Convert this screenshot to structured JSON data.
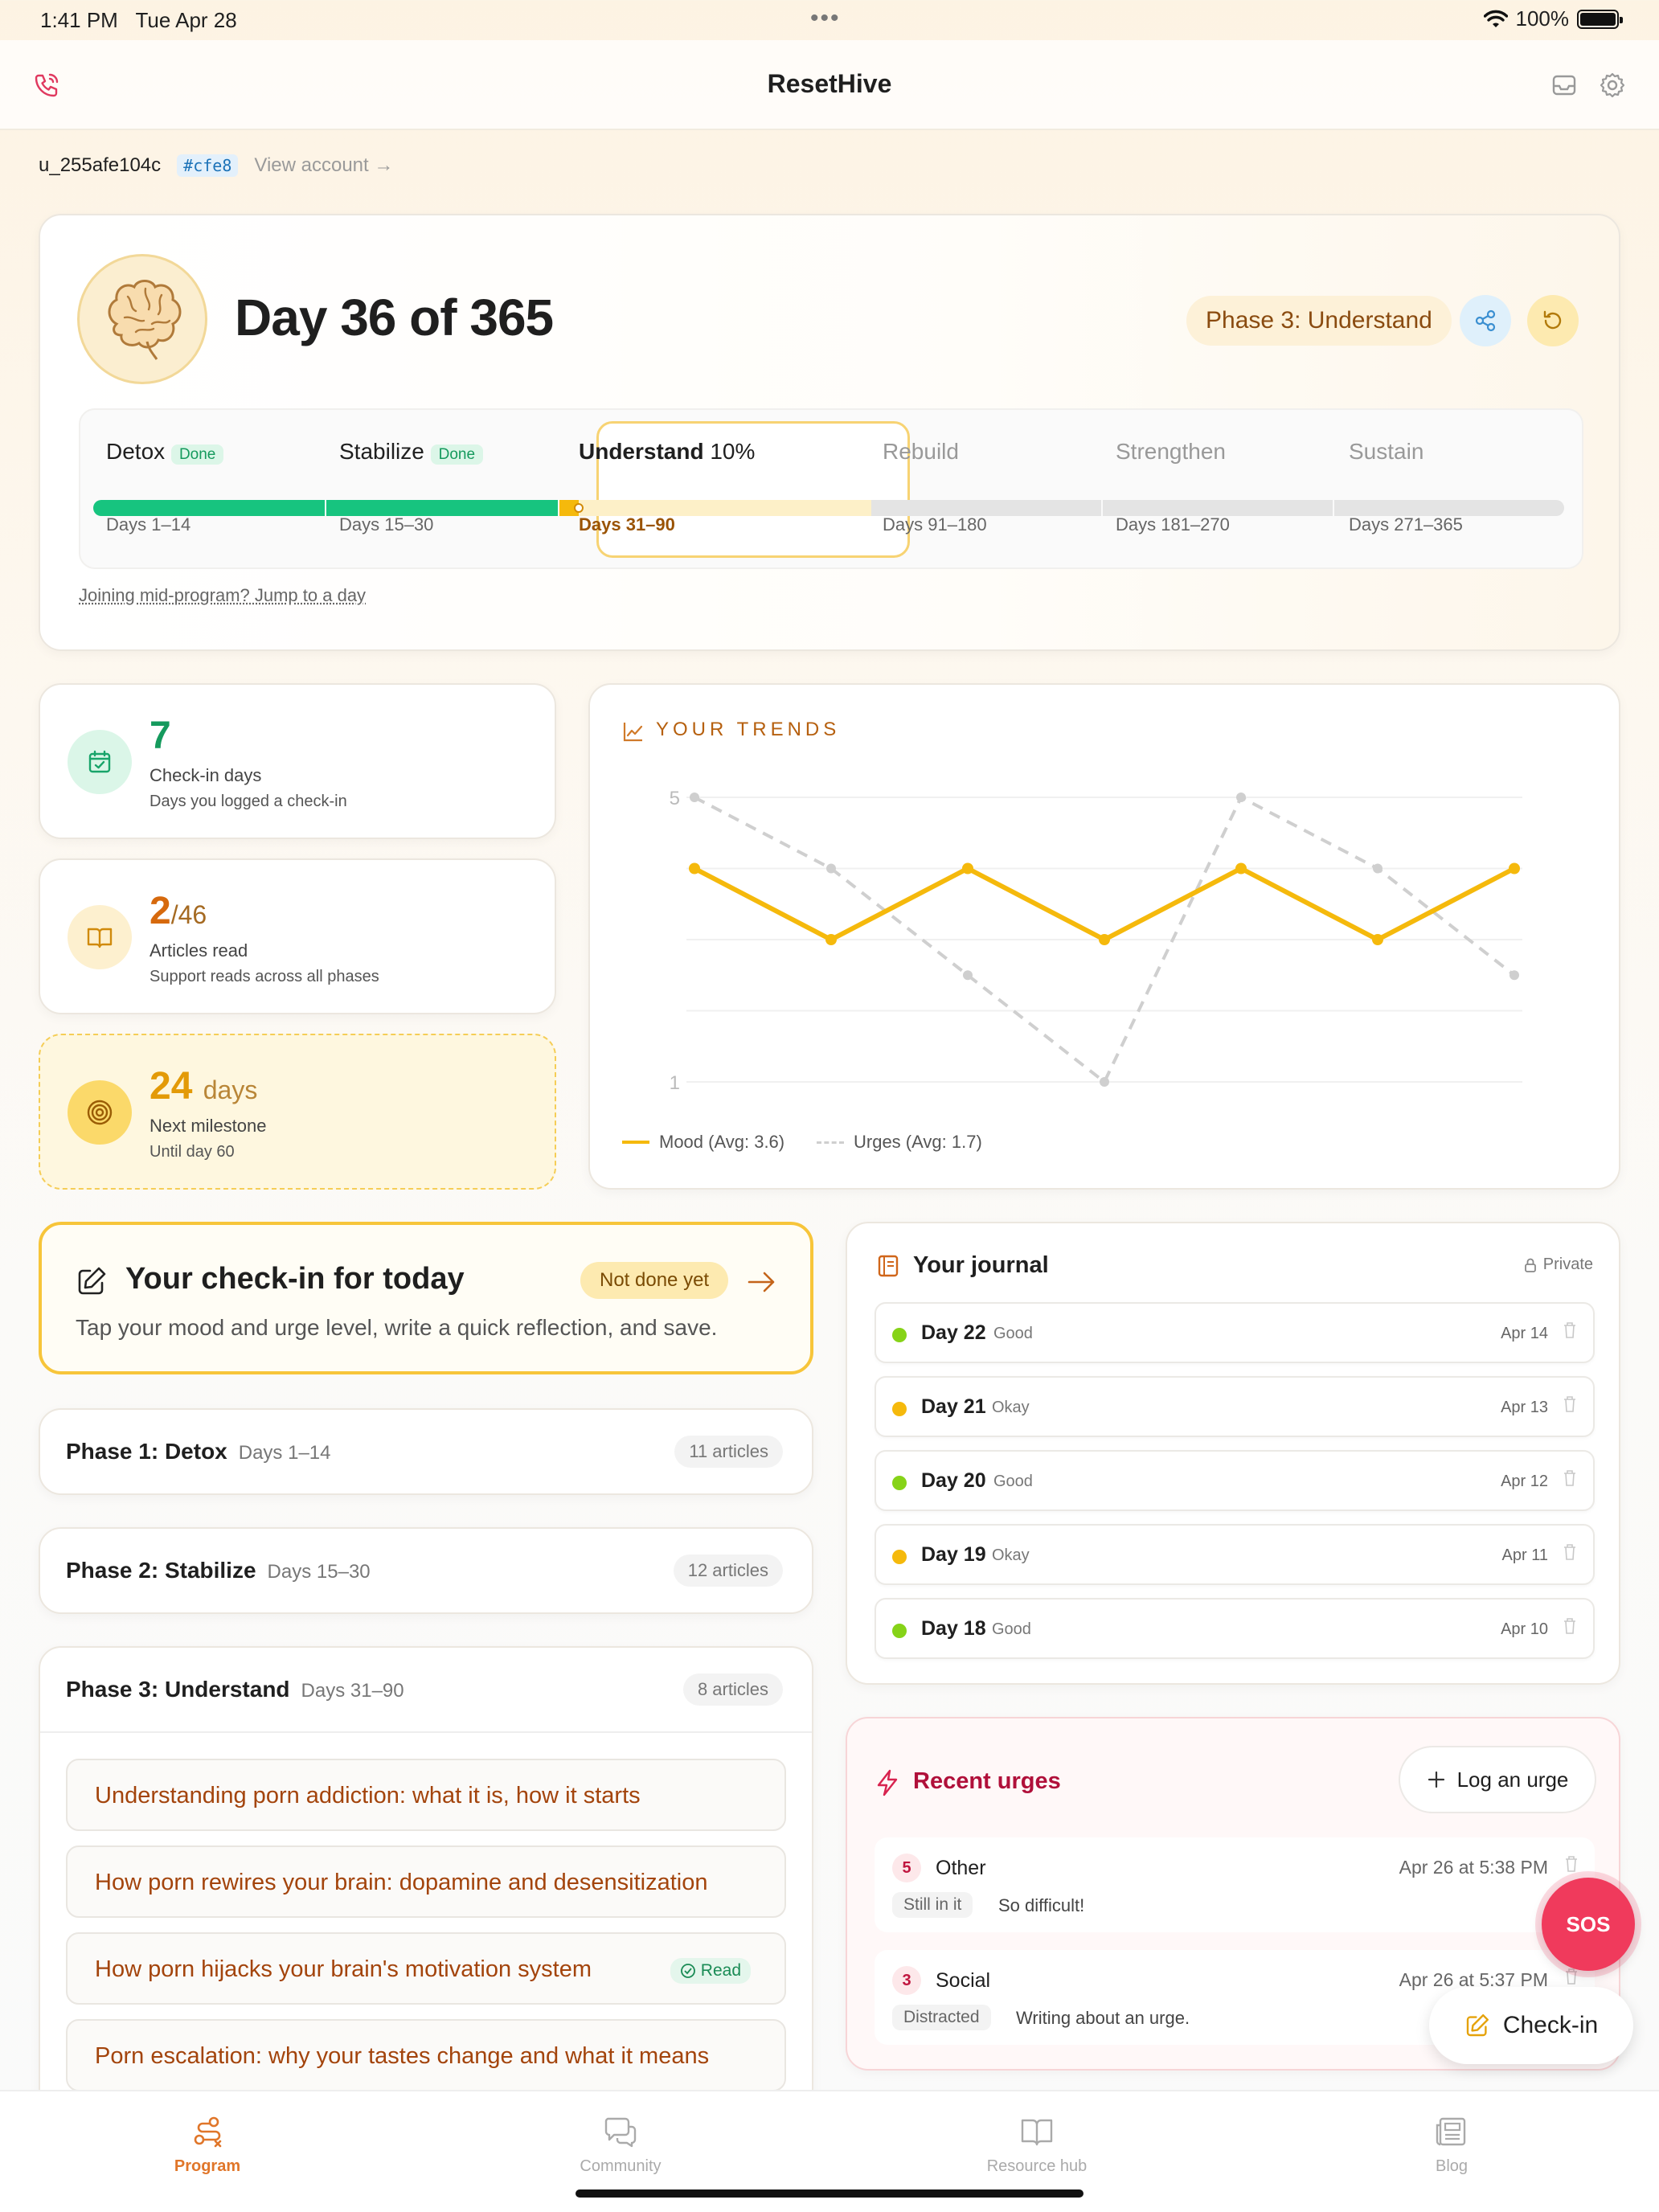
{
  "status": {
    "time": "1:41 PM",
    "date": "Tue Apr 28",
    "battery": "100%"
  },
  "header": {
    "title": "ResetHive"
  },
  "account": {
    "id": "u_255afe104c",
    "tag": "#cfe8",
    "link": "View account"
  },
  "hero": {
    "day_title": "Day 36 of 365",
    "phase_pill": "Phase 3: Understand",
    "jump_link": "Joining mid-program? Jump to a day",
    "current_phase_progress": 0.1,
    "phases": [
      {
        "name": "Detox",
        "badge": "Done",
        "days": "Days 1–14"
      },
      {
        "name": "Stabilize",
        "badge": "Done",
        "days": "Days 15–30"
      },
      {
        "name": "Understand",
        "badge": "10%",
        "days": "Days 31–90"
      },
      {
        "name": "Rebuild",
        "days": "Days 91–180"
      },
      {
        "name": "Strengthen",
        "days": "Days 181–270"
      },
      {
        "name": "Sustain",
        "days": "Days 271–365"
      }
    ],
    "colors": {
      "done": "#17c47f",
      "current": "#f5b90c",
      "pending": "#e4e4e4"
    }
  },
  "stats": {
    "checkins": {
      "value": "7",
      "label": "Check-in days",
      "desc": "Days you logged a check-in"
    },
    "articles": {
      "value": "2",
      "total": "/46",
      "label": "Articles read",
      "desc": "Support reads across all phases"
    },
    "milestone": {
      "value": "24",
      "unit": "days",
      "label": "Next milestone",
      "desc": "Until day 60"
    }
  },
  "trends": {
    "title": "YOUR TRENDS",
    "legend_mood": "Mood (Avg: 3.6)",
    "legend_urges": "Urges (Avg: 1.7)"
  },
  "chart_data": {
    "type": "line",
    "x": [
      1,
      2,
      3,
      4,
      5,
      6,
      7
    ],
    "ylim": [
      1,
      5
    ],
    "y_ticks": [
      "5",
      "1"
    ],
    "grid": true,
    "legend_placement": "bottom-left",
    "series": [
      {
        "name": "Mood (Avg: 3.6)",
        "values": [
          4,
          3,
          4,
          3,
          4,
          3,
          4
        ],
        "color": "#f5b90c",
        "style": "solid"
      },
      {
        "name": "Urges (Avg: 1.7)",
        "values": [
          5,
          4,
          2.5,
          1,
          5,
          4,
          2.5
        ],
        "color": "#cfcfcf",
        "style": "dashed"
      }
    ]
  },
  "today": {
    "title": "Your check-in for today",
    "badge": "Not done yet",
    "desc": "Tap your mood and urge level, write a quick reflection, and save."
  },
  "phase_cards": [
    {
      "name": "Phase 1: Detox",
      "days": "Days 1–14",
      "count": "11 articles"
    },
    {
      "name": "Phase 2: Stabilize",
      "days": "Days 15–30",
      "count": "12 articles"
    },
    {
      "name": "Phase 3: Understand",
      "days": "Days 31–90",
      "count": "8 articles"
    }
  ],
  "articles": [
    {
      "title": "Understanding porn addiction: what it is, how it starts"
    },
    {
      "title": "How porn rewires your brain: dopamine and desensitization"
    },
    {
      "title": "How porn hijacks your brain's motivation system",
      "read": "Read"
    },
    {
      "title": "Porn escalation: why your tastes change and what it means"
    }
  ],
  "journal": {
    "title": "Your journal",
    "private": "Private",
    "entries": [
      {
        "day": "Day 22",
        "mood": "Good",
        "date": "Apr 14",
        "color": "#86d318"
      },
      {
        "day": "Day 21",
        "mood": "Okay",
        "date": "Apr 13",
        "color": "#f5b90c"
      },
      {
        "day": "Day 20",
        "mood": "Good",
        "date": "Apr 12",
        "color": "#86d318"
      },
      {
        "day": "Day 19",
        "mood": "Okay",
        "date": "Apr 11",
        "color": "#f5b90c"
      },
      {
        "day": "Day 18",
        "mood": "Good",
        "date": "Apr 10",
        "color": "#86d318"
      }
    ]
  },
  "urges": {
    "title": "Recent urges",
    "log_button": "Log an urge",
    "items": [
      {
        "level": "5",
        "type": "Other",
        "date": "Apr 26 at 5:38 PM",
        "chip": "Still in it",
        "note": "So difficult!"
      },
      {
        "level": "3",
        "type": "Social",
        "date": "Apr 26 at 5:37 PM",
        "chip": "Distracted",
        "note": "Writing about an urge."
      }
    ]
  },
  "fab": {
    "sos": "SOS",
    "checkin": "Check-in"
  },
  "nav": [
    {
      "label": "Program",
      "icon": "program-icon"
    },
    {
      "label": "Community",
      "icon": "community-icon"
    },
    {
      "label": "Resource hub",
      "icon": "book-icon"
    },
    {
      "label": "Blog",
      "icon": "newspaper-icon"
    }
  ]
}
